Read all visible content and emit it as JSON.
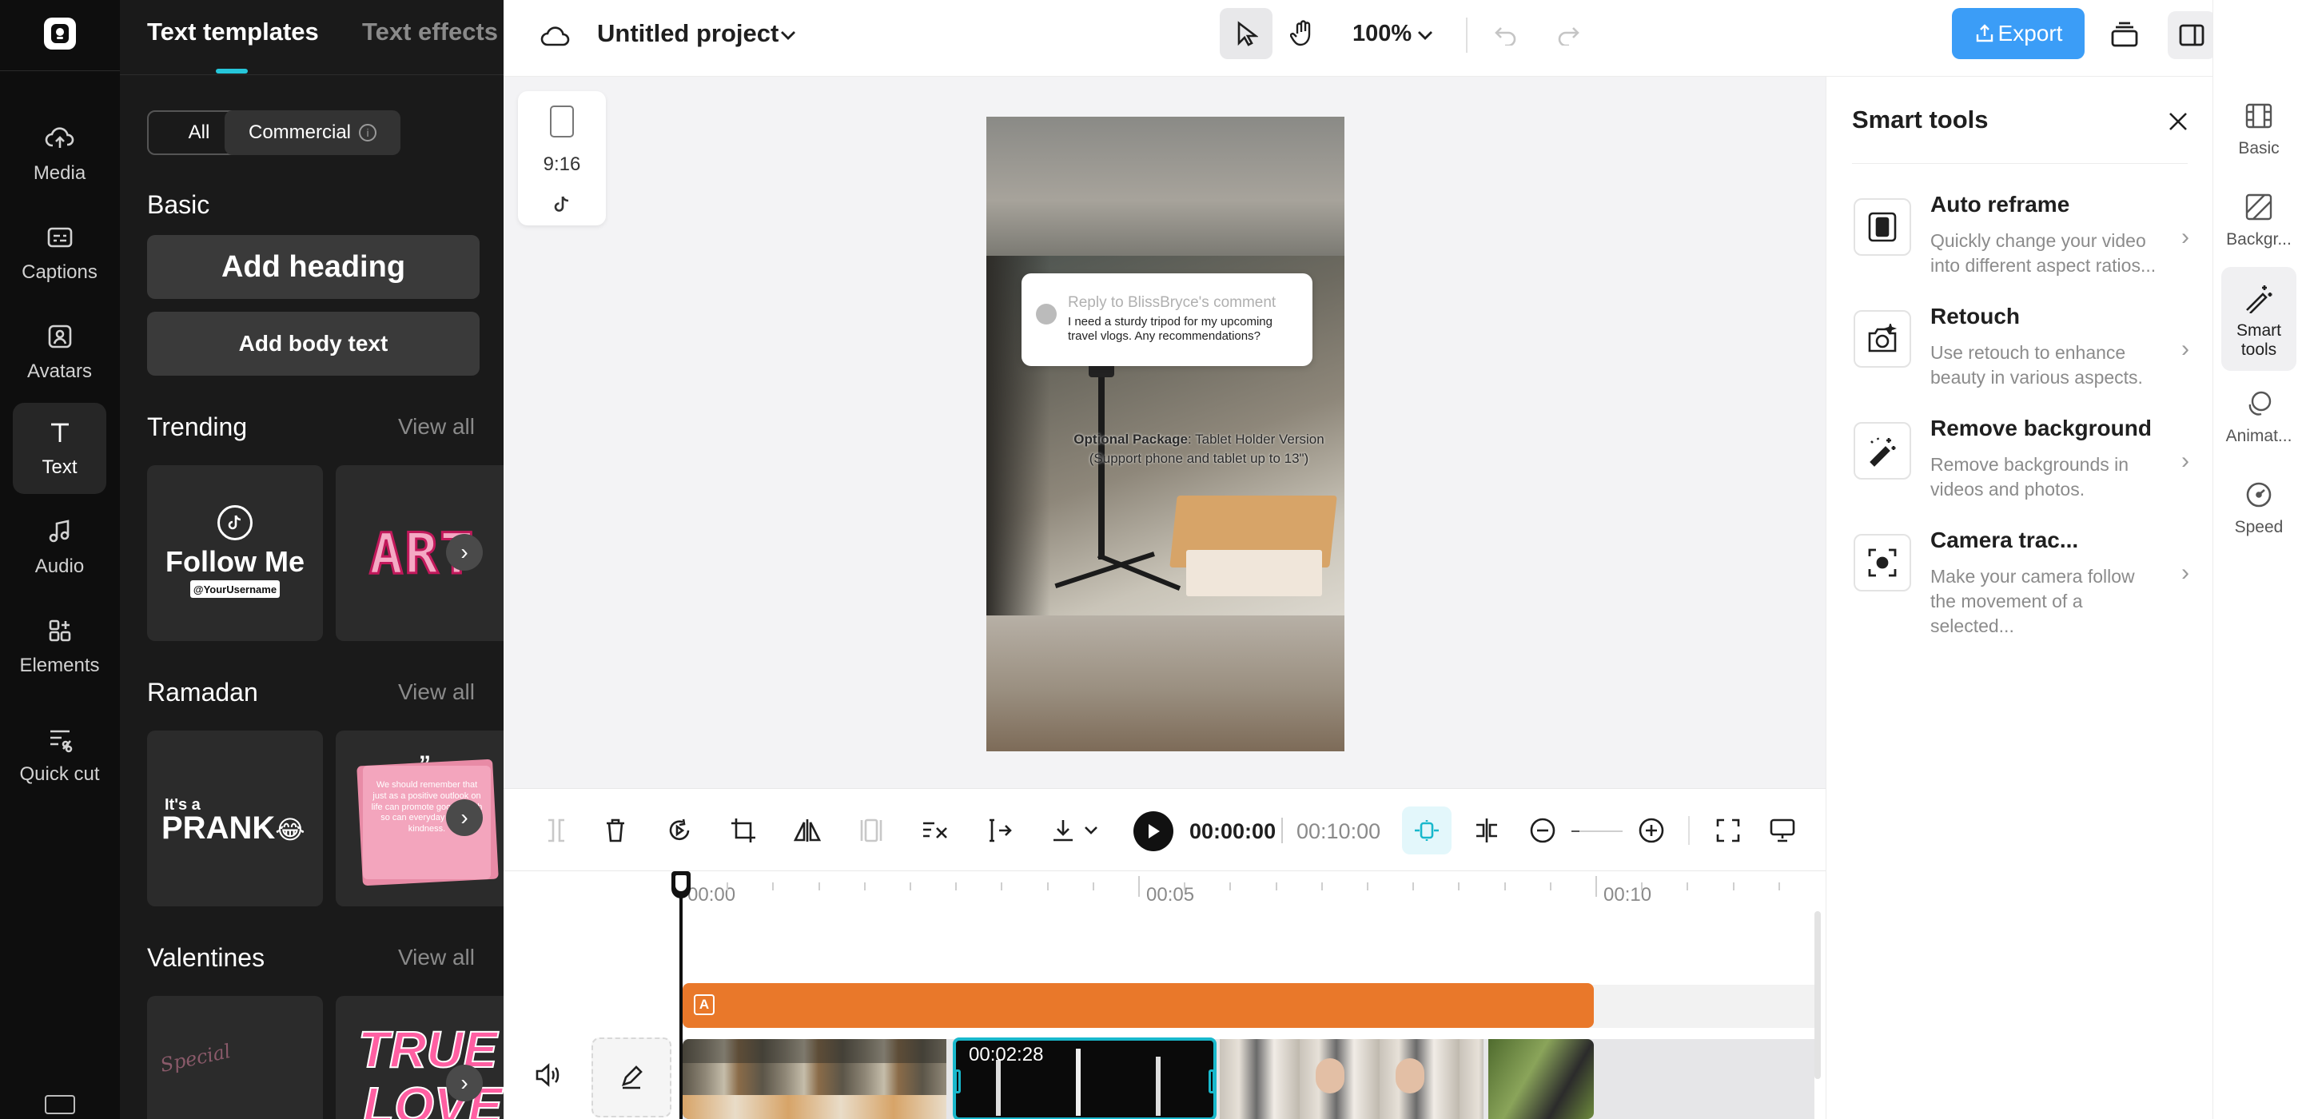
{
  "sidebar": {
    "items": [
      {
        "label": "Media",
        "icon": "cloud-upload-icon"
      },
      {
        "label": "Captions",
        "icon": "captions-icon"
      },
      {
        "label": "Avatars",
        "icon": "avatar-icon"
      },
      {
        "label": "Text",
        "icon": "text-icon"
      },
      {
        "label": "Audio",
        "icon": "music-note-icon"
      },
      {
        "label": "Elements",
        "icon": "elements-grid-icon"
      },
      {
        "label": "Quick cut",
        "icon": "quick-cut-icon"
      }
    ]
  },
  "panel": {
    "tabs": {
      "active": "Text templates",
      "inactive": "Text effects"
    },
    "chips": {
      "all": "All",
      "commercial": "Commercial"
    },
    "basic": {
      "title": "Basic",
      "heading": "Add heading",
      "body": "Add body text"
    },
    "sections": {
      "trending": "Trending",
      "ramadan": "Ramadan",
      "valentines": "Valentines",
      "view_all": "View all"
    },
    "cards": {
      "follow_title": "Follow Me",
      "follow_user": "@YourUsername",
      "art": "ART",
      "its_a": "It's a",
      "prank": "PRANK",
      "prank_emoji": "😂",
      "quote": "We should remember that just as a positive outlook on life can promote good health so can everyday acts of kindness.",
      "special": "Special",
      "true": "TRUE",
      "love": "LOVE"
    }
  },
  "topbar": {
    "project_name": "Untitled project",
    "zoom": "100%",
    "export_label": "Export"
  },
  "canvas": {
    "aspect_ratio": "9:16",
    "comment_header": "Reply to BlissBryce's comment",
    "comment_body": "I need a sturdy tripod for my upcoming travel vlogs. Any recommendations?",
    "overlay_bold": "Optional Package",
    "overlay_rest": ": Tablet Holder Version",
    "overlay_line2": "(Support phone and tablet up to 13\")"
  },
  "toolbar": {
    "current_time": "00:00:00",
    "total_time": "00:10:00"
  },
  "timeline": {
    "ticks": [
      "00:00",
      "00:05",
      "00:10"
    ],
    "clip_time": "00:02:28"
  },
  "smart_tools": {
    "title": "Smart tools",
    "items": [
      {
        "name": "Auto reframe",
        "desc": "Quickly change your video into different aspect ratios..."
      },
      {
        "name": "Retouch",
        "desc": "Use retouch to enhance beauty in various aspects."
      },
      {
        "name": "Remove background",
        "desc": "Remove backgrounds in videos and photos."
      },
      {
        "name": "Camera trac...",
        "desc": "Make your camera follow the movement of a selected..."
      }
    ]
  },
  "rail": {
    "items": [
      {
        "label": "Basic"
      },
      {
        "label": "Backgr..."
      },
      {
        "label": "Smart tools"
      },
      {
        "label": "Animat..."
      },
      {
        "label": "Speed"
      }
    ]
  },
  "colors": {
    "accent": "#26c6da",
    "export": "#3b9df7",
    "text_track": "#e9782a",
    "selected_clip": "#18b8cc"
  }
}
